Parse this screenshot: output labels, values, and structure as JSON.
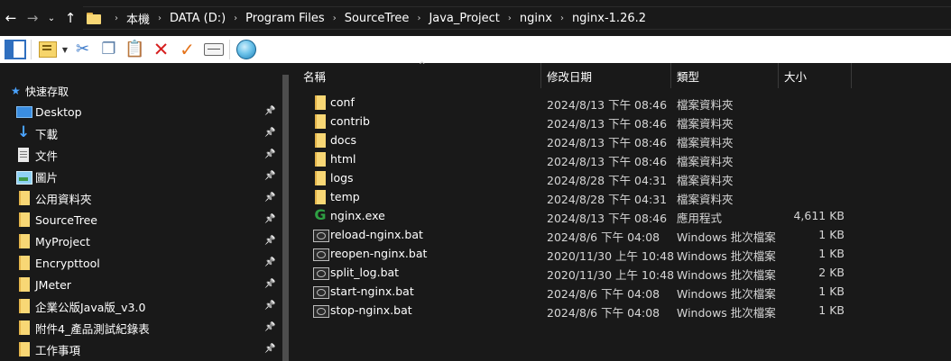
{
  "address_bar": {
    "breadcrumb": [
      "本機",
      "DATA (D:)",
      "Program Files",
      "SourceTree",
      "Java_Project",
      "nginx",
      "nginx-1.26.2"
    ]
  },
  "icons": {
    "back": "arrow-left-icon",
    "forward": "arrow-right-icon",
    "recent": "chevron-down-icon",
    "up": "arrow-up-icon",
    "pin": "pin-icon"
  },
  "colors": {
    "background": "#191919",
    "toolbar": "#ffffff",
    "folder": "#f8d775",
    "quick_access_star": "#4aa3ff",
    "delete": "#d62020",
    "check": "#e4731b"
  },
  "navigation": {
    "quick_access": "快速存取",
    "items": [
      {
        "label": "Desktop",
        "icon": "desktop-icon"
      },
      {
        "label": "下載",
        "icon": "download-icon"
      },
      {
        "label": "文件",
        "icon": "document-icon"
      },
      {
        "label": "圖片",
        "icon": "picture-icon"
      },
      {
        "label": "公用資料夾",
        "icon": "folder-icon"
      },
      {
        "label": "SourceTree",
        "icon": "folder-icon"
      },
      {
        "label": "MyProject",
        "icon": "folder-icon"
      },
      {
        "label": "Encrypttool",
        "icon": "folder-icon"
      },
      {
        "label": "JMeter",
        "icon": "folder-icon"
      },
      {
        "label": "企業公版Java版_v3.0",
        "icon": "folder-icon"
      },
      {
        "label": "附件4_產品測試紀錄表",
        "icon": "folder-icon"
      },
      {
        "label": "工作事項",
        "icon": "folder-icon"
      }
    ]
  },
  "columns": {
    "name": "名稱",
    "date": "修改日期",
    "type": "類型",
    "size": "大小"
  },
  "files": [
    {
      "name": "conf",
      "date": "2024/8/13 下午 08:46",
      "type": "檔案資料夾",
      "size": "",
      "icon": "folder-icon"
    },
    {
      "name": "contrib",
      "date": "2024/8/13 下午 08:46",
      "type": "檔案資料夾",
      "size": "",
      "icon": "folder-icon"
    },
    {
      "name": "docs",
      "date": "2024/8/13 下午 08:46",
      "type": "檔案資料夾",
      "size": "",
      "icon": "folder-icon"
    },
    {
      "name": "html",
      "date": "2024/8/13 下午 08:46",
      "type": "檔案資料夾",
      "size": "",
      "icon": "folder-icon"
    },
    {
      "name": "logs",
      "date": "2024/8/28 下午 04:31",
      "type": "檔案資料夾",
      "size": "",
      "icon": "folder-icon"
    },
    {
      "name": "temp",
      "date": "2024/8/28 下午 04:31",
      "type": "檔案資料夾",
      "size": "",
      "icon": "folder-icon"
    },
    {
      "name": "nginx.exe",
      "date": "2024/8/13 下午 08:46",
      "type": "應用程式",
      "size": "4,611 KB",
      "icon": "exe-icon"
    },
    {
      "name": "reload-nginx.bat",
      "date": "2024/8/6 下午 04:08",
      "type": "Windows 批次檔案",
      "size": "1 KB",
      "icon": "bat-file-icon"
    },
    {
      "name": "reopen-nginx.bat",
      "date": "2020/11/30 上午 10:48",
      "type": "Windows 批次檔案",
      "size": "1 KB",
      "icon": "bat-file-icon"
    },
    {
      "name": "split_log.bat",
      "date": "2020/11/30 上午 10:48",
      "type": "Windows 批次檔案",
      "size": "2 KB",
      "icon": "bat-file-icon"
    },
    {
      "name": "start-nginx.bat",
      "date": "2024/8/6 下午 04:08",
      "type": "Windows 批次檔案",
      "size": "1 KB",
      "icon": "bat-file-icon"
    },
    {
      "name": "stop-nginx.bat",
      "date": "2024/8/6 下午 04:08",
      "type": "Windows 批次檔案",
      "size": "1 KB",
      "icon": "bat-file-icon"
    }
  ]
}
